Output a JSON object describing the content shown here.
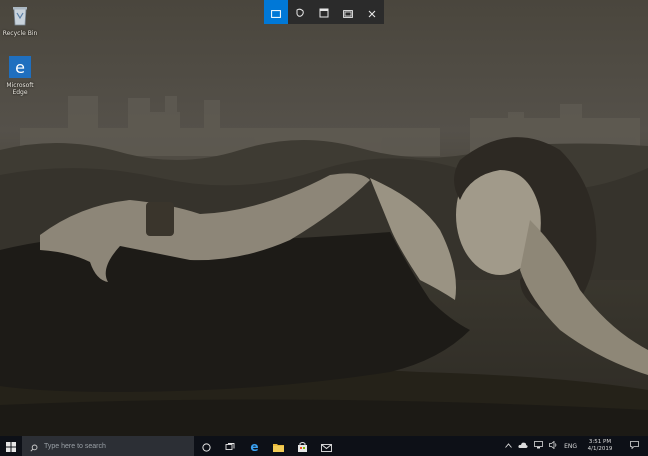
{
  "desktop": {
    "icons": [
      {
        "label": "Recycle Bin",
        "icon": "recycle-bin-icon"
      },
      {
        "label": "Microsoft Edge",
        "icon": "edge-icon"
      }
    ]
  },
  "snip_toolbar": {
    "tools": [
      {
        "name": "rectangular-snip",
        "icon": "rectangle-snip-icon",
        "active": true
      },
      {
        "name": "freeform-snip",
        "icon": "freeform-snip-icon",
        "active": false
      },
      {
        "name": "window-snip",
        "icon": "window-snip-icon",
        "active": false
      },
      {
        "name": "fullscreen-snip",
        "icon": "fullscreen-snip-icon",
        "active": false
      },
      {
        "name": "close",
        "icon": "close-icon",
        "active": false
      }
    ],
    "accent": "#0078d7"
  },
  "taskbar": {
    "search_placeholder": "Type here to search",
    "apps": [
      "cortana-icon",
      "task-view-icon",
      "edge-icon",
      "file-explorer-icon",
      "store-icon",
      "mail-icon"
    ],
    "tray": {
      "language": "ENG",
      "time": "3:51 PM",
      "date": "4/1/2019"
    }
  }
}
